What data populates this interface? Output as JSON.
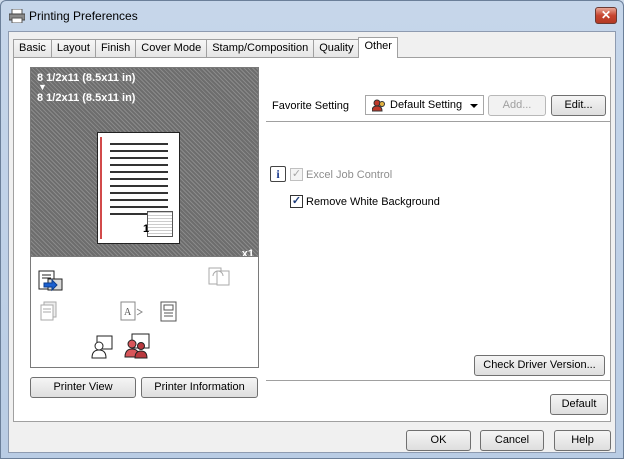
{
  "window": {
    "title": "Printing Preferences",
    "close_symbol": "✕"
  },
  "tabs": [
    {
      "label": "Basic"
    },
    {
      "label": "Layout"
    },
    {
      "label": "Finish"
    },
    {
      "label": "Cover Mode"
    },
    {
      "label": "Stamp/Composition"
    },
    {
      "label": "Quality"
    },
    {
      "label": "Other"
    }
  ],
  "active_tab": "Other",
  "preview": {
    "original_size": "8 1/2x11 (8.5x11 in)",
    "arrow": "▼",
    "output_size": "8 1/2x11 (8.5x11 in)",
    "page_number": "1",
    "copies": "x1"
  },
  "left_buttons": {
    "printer_view": "Printer View",
    "printer_information": "Printer Information"
  },
  "favorite": {
    "label": "Favorite Setting",
    "selected": "Default Setting",
    "add_button": "Add...",
    "edit_button": "Edit..."
  },
  "options": {
    "excel_job_control": {
      "label": "Excel Job Control",
      "checked": true,
      "enabled": false
    },
    "remove_white_background": {
      "label": "Remove White Background",
      "checked": true,
      "enabled": true
    }
  },
  "check_driver_version_button": "Check Driver Version...",
  "default_button": "Default",
  "bottom_buttons": {
    "ok": "OK",
    "cancel": "Cancel",
    "help": "Help"
  },
  "checkmark": "✓",
  "info_symbol": "i"
}
